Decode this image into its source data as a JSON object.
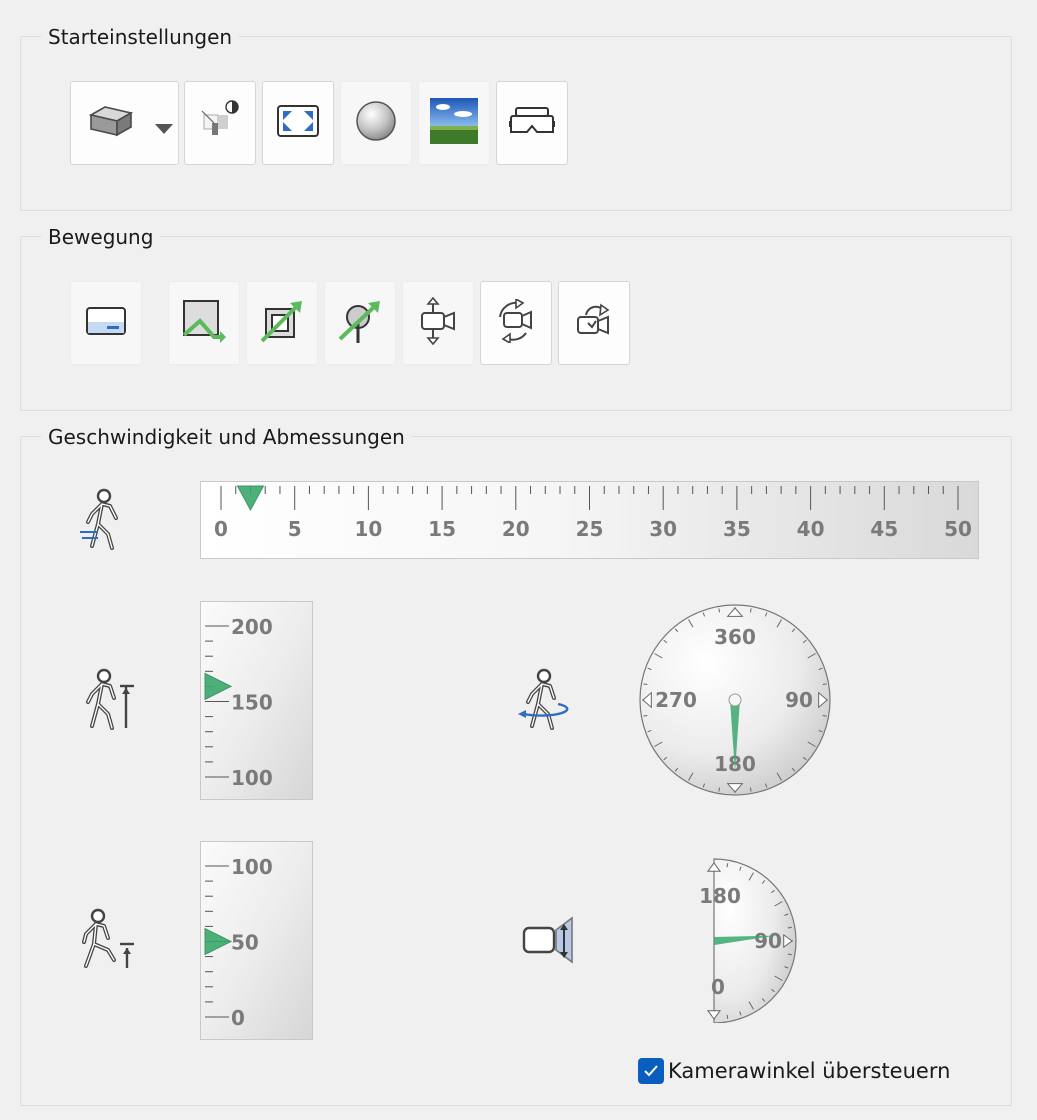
{
  "groups": {
    "start": {
      "title": "Starteinstellungen"
    },
    "motion": {
      "title": "Bewegung"
    },
    "speed": {
      "title": "Geschwindigkeit und Abmessungen"
    }
  },
  "walk_speed": {
    "min": 0,
    "max": 50,
    "value": 2,
    "ticks": [
      "0",
      "5",
      "10",
      "15",
      "20",
      "25",
      "30",
      "35",
      "40",
      "45",
      "50"
    ]
  },
  "eye_height": {
    "min": 100,
    "max": 200,
    "value": 160,
    "ticks": [
      "200",
      "150",
      "100"
    ]
  },
  "step_height": {
    "min": 0,
    "max": 100,
    "value": 50,
    "ticks": [
      "100",
      "50",
      "0"
    ]
  },
  "heading_dial": {
    "value": 180,
    "labels": [
      "360",
      "90",
      "180",
      "270"
    ]
  },
  "pitch_dial": {
    "value": 95,
    "labels": [
      "180",
      "90",
      "0"
    ]
  },
  "override": {
    "label": "Kamerawinkel übersteuern",
    "checked": true
  },
  "colors": {
    "accent": "#0a5ebd",
    "marker": "#3aa86b",
    "icon": "#555555",
    "arrow_green": "#5cba5c",
    "blue": "#2f6cc4"
  },
  "icons": [
    "box-view-icon",
    "dropdown-arrow-icon",
    "lighting-cube-icon",
    "fit-view-icon",
    "sphere-icon",
    "sky-background-icon",
    "vr-headset-icon",
    "screen-icon",
    "walk-path-icon",
    "fly-path-icon",
    "tree-path-icon",
    "camera-pan-icon",
    "camera-orbit-icon",
    "camera-turn-icon",
    "walker-speed-icon",
    "walker-height-icon",
    "walker-turn-icon",
    "walker-step-icon",
    "camera-tilt-icon"
  ]
}
